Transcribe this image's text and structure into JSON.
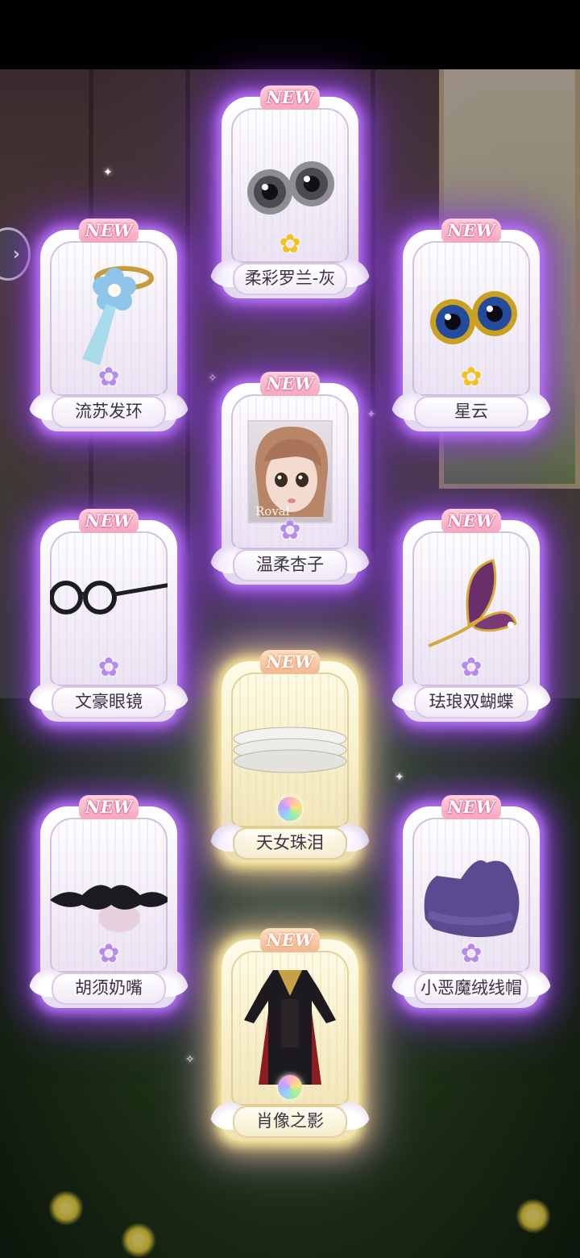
{
  "badge_text": "NEW",
  "side_button_icon": "chevron-right-icon",
  "cards": [
    {
      "name": "柔彩罗兰-灰",
      "rarity": "yellow",
      "frame": "purple",
      "art": "eyes-grey-icon"
    },
    {
      "name": "流苏发环",
      "rarity": "purple",
      "frame": "purple",
      "art": "tassel-hairpin-icon"
    },
    {
      "name": "星云",
      "rarity": "yellow",
      "frame": "purple",
      "art": "eyes-nebula-icon"
    },
    {
      "name": "温柔杏子",
      "rarity": "purple",
      "frame": "purple",
      "art": "portrait-icon",
      "caption": "Roval"
    },
    {
      "name": "文豪眼镜",
      "rarity": "purple",
      "frame": "purple",
      "art": "round-glasses-icon"
    },
    {
      "name": "珐琅双蝴蝶",
      "rarity": "purple",
      "frame": "purple",
      "art": "butterfly-brooch-icon"
    },
    {
      "name": "天女珠泪",
      "rarity": "rainbow",
      "frame": "gold",
      "art": "pearl-choker-icon"
    },
    {
      "name": "胡须奶嘴",
      "rarity": "purple",
      "frame": "purple",
      "art": "mustache-pacifier-icon"
    },
    {
      "name": "小恶魔绒线帽",
      "rarity": "purple",
      "frame": "purple",
      "art": "knit-hat-icon"
    },
    {
      "name": "肖像之影",
      "rarity": "rainbow",
      "frame": "gold",
      "art": "black-outfit-icon"
    }
  ]
}
